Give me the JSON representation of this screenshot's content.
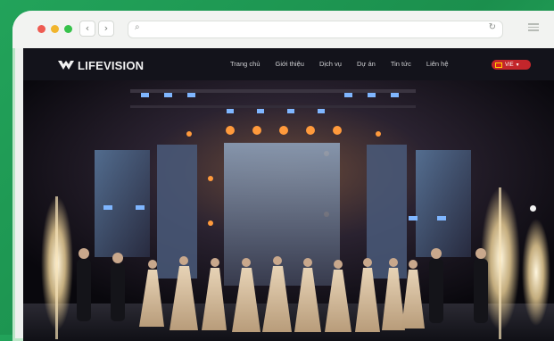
{
  "browser": {
    "back_glyph": "‹",
    "forward_glyph": "›",
    "search_glyph": "⌕",
    "reload_glyph": "↻"
  },
  "site": {
    "logo_text": "LIFEVISION",
    "nav": [
      "Trang chủ",
      "Giới thiệu",
      "Dịch vụ",
      "Dự án",
      "Tin tức",
      "Liên hệ"
    ],
    "language": "VIE",
    "accent_color": "#c3262b"
  },
  "hero": {
    "image": "stage-event-photo",
    "slider_count": 1
  },
  "background_color": "#22a35a"
}
